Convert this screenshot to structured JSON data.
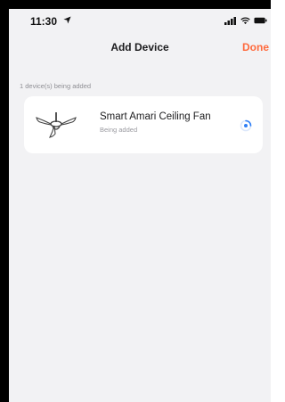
{
  "status_bar": {
    "time": "11:30",
    "icons": [
      "location-arrow-icon",
      "signal-icon",
      "wifi-icon",
      "battery-icon"
    ]
  },
  "header": {
    "title": "Add Device",
    "done_label": "Done"
  },
  "section": {
    "label": "1 device(s) being added"
  },
  "devices": [
    {
      "name": "Smart Amari Ceiling Fan",
      "status": "Being added",
      "icon": "ceiling-fan-icon",
      "progress_icon": "loading-spinner-icon"
    }
  ],
  "colors": {
    "accent": "#ff6a3d",
    "background": "#f2f2f4",
    "card": "#ffffff",
    "spinner": "#2f7ff6"
  }
}
